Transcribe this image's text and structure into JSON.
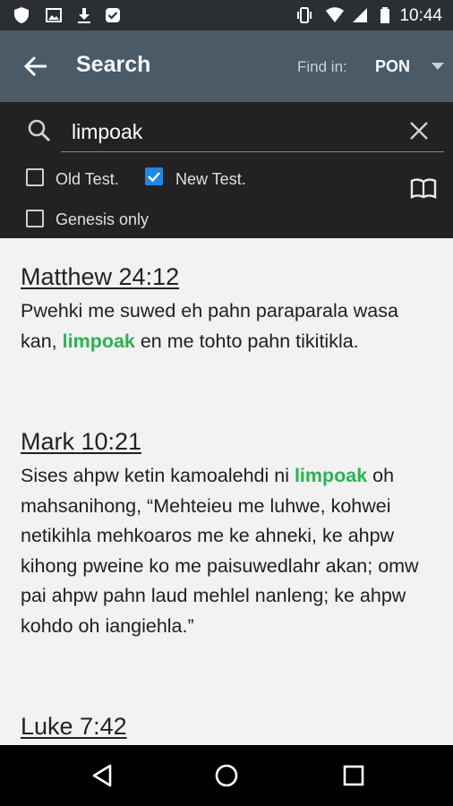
{
  "status_bar": {
    "time": "10:44",
    "icons": [
      "shield-icon",
      "image-icon",
      "download-icon",
      "check-badge-icon",
      "vibrate-icon",
      "wifi-icon",
      "signal-icon",
      "battery-icon"
    ]
  },
  "app_bar": {
    "title": "Search",
    "find_in_label": "Find in:",
    "version": "PON",
    "background": "#4a5a66"
  },
  "search": {
    "query": "limpoak",
    "filters": [
      {
        "label": "Old Test.",
        "checked": false
      },
      {
        "label": "New Test.",
        "checked": true
      },
      {
        "label": "Genesis only",
        "checked": false
      }
    ]
  },
  "results": [
    {
      "reference": "Matthew 24:12",
      "before": "Pwehki me suwed eh pahn paraparala wasa kan, ",
      "match": "limpoak",
      "after": " en me tohto pahn tikitikla."
    },
    {
      "reference": "Mark 10:21",
      "before": "Sises ahpw ketin kamoalehdi ni ",
      "match": "limpoak",
      "after": " oh mahsanihong, “Mehteieu me luhwe, kohwei netikihla mehkoaros me ke ahneki, ke ahpw kihong pweine ko me paisuwedlahr akan; omw pai ahpw pahn laud mehlel nanleng; ke ahpw kohdo oh iangiehla.”"
    },
    {
      "reference": "Luke 7:42"
    }
  ],
  "colors": {
    "highlight": "#27b44f",
    "checkbox_checked": "#1e88e5",
    "panel": "#222222"
  }
}
